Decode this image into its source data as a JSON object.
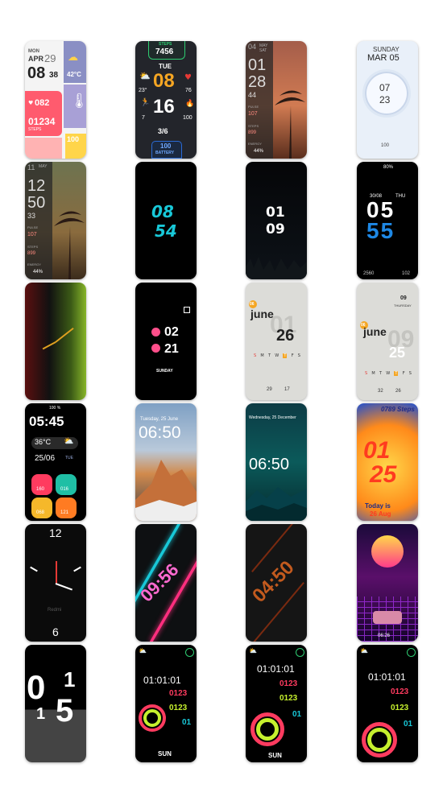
{
  "colors": {
    "accent_orange": "#f5a623",
    "accent_red": "#e53935",
    "neon_cyan": "#18c8d8",
    "neon_pink": "#ff2e7e",
    "screen_bg": "#000000"
  },
  "f1": {
    "day": "MON",
    "month": "APR",
    "date": "29",
    "hour": "08",
    "minute": "38",
    "temp": "42°C",
    "heart": "082",
    "steps": "01234",
    "steps_label": "STEPS",
    "battery": "100"
  },
  "f2": {
    "steps_label": "STEPS",
    "steps": "7456",
    "day": "TUE",
    "hour": "08",
    "minute": "16",
    "temp": "23°",
    "heart": "76",
    "hi": "7",
    "fire": "100",
    "date": "3/6",
    "battery": "100",
    "battery_label": "BATTERY"
  },
  "f3": {
    "month": "04",
    "day": "MAY",
    "weekday": "SAT",
    "hour": "01",
    "minute": "28",
    "sec": "44",
    "pulse_label": "PULSE",
    "pulse": "107",
    "steps_label": "STEPS",
    "steps": "899",
    "energy_label": "ENERGY",
    "energy": "44%"
  },
  "f4": {
    "weekday": "SUNDAY",
    "date": "MAR 05",
    "hour": "07",
    "minute": "23",
    "battery": "100"
  },
  "f5": {
    "month": "11",
    "day": "MAY",
    "hour": "12",
    "minute": "50",
    "sec": "33",
    "pulse_label": "PULSE",
    "pulse": "107",
    "steps_label": "STEPS",
    "steps": "899",
    "energy_label": "ENERGY",
    "energy": "44%"
  },
  "f6": {
    "hour": "08",
    "minute": "54"
  },
  "f7": {
    "hour": "01",
    "minute": "09"
  },
  "f8": {
    "battery": "80%",
    "date": "30/08",
    "weekday": "THU",
    "hour": "05",
    "minute": "55",
    "steps": "2560",
    "heart": "102"
  },
  "f10": {
    "hour_a": "02",
    "hour_b": "21",
    "weekday": "SUNDAY"
  },
  "f11": {
    "badge": "06",
    "month": "june",
    "day_bg": "01",
    "day": "26",
    "weekdays": [
      "S",
      "M",
      "T",
      "W",
      "T",
      "F",
      "S"
    ],
    "temp": "29",
    "battery": "17"
  },
  "f12": {
    "badge": "06",
    "month": "june",
    "day_bg": "09",
    "day": "25",
    "mini_time": "09",
    "mini_weekday": "THURSDAY",
    "weekdays": [
      "S",
      "M",
      "T",
      "W",
      "T",
      "F",
      "S"
    ],
    "temp": "32",
    "battery": "26"
  },
  "f13": {
    "battery": "100 %",
    "time": "05:45",
    "temp": "36°C",
    "date": "25/06",
    "weekday": "TUE",
    "heart": "160",
    "steps": "016",
    "kcal": "068",
    "fire": "121"
  },
  "f14": {
    "date": "Tuesday, 25 June",
    "time": "06:50"
  },
  "f15": {
    "date": "Wednesday, 25 December",
    "time": "06:50"
  },
  "f16": {
    "steps": "0789 Steps",
    "hour": "01",
    "minute": "25",
    "today": "Today is",
    "date": "26 Aug"
  },
  "f17": {
    "n12": "12",
    "n6": "6",
    "brand": "Redmi"
  },
  "f18": {
    "time": "09:56"
  },
  "f19": {
    "time": "04:50"
  },
  "f20": {
    "time": "06:26"
  },
  "f21": {
    "h1": "0",
    "h2": "1",
    "m1": "1",
    "m2": "5"
  },
  "f22": {
    "time": "01:01:01",
    "line1": "0123",
    "line2": "0123",
    "line3": "01",
    "weekday": "SUN"
  },
  "f23": {
    "time": "01:01:01",
    "line1": "0123",
    "line2": "0123",
    "line3": "01",
    "weekday": "SUN"
  },
  "f24": {
    "time": "01:01:01",
    "line1": "0123",
    "line2": "0123",
    "line3": "01"
  }
}
